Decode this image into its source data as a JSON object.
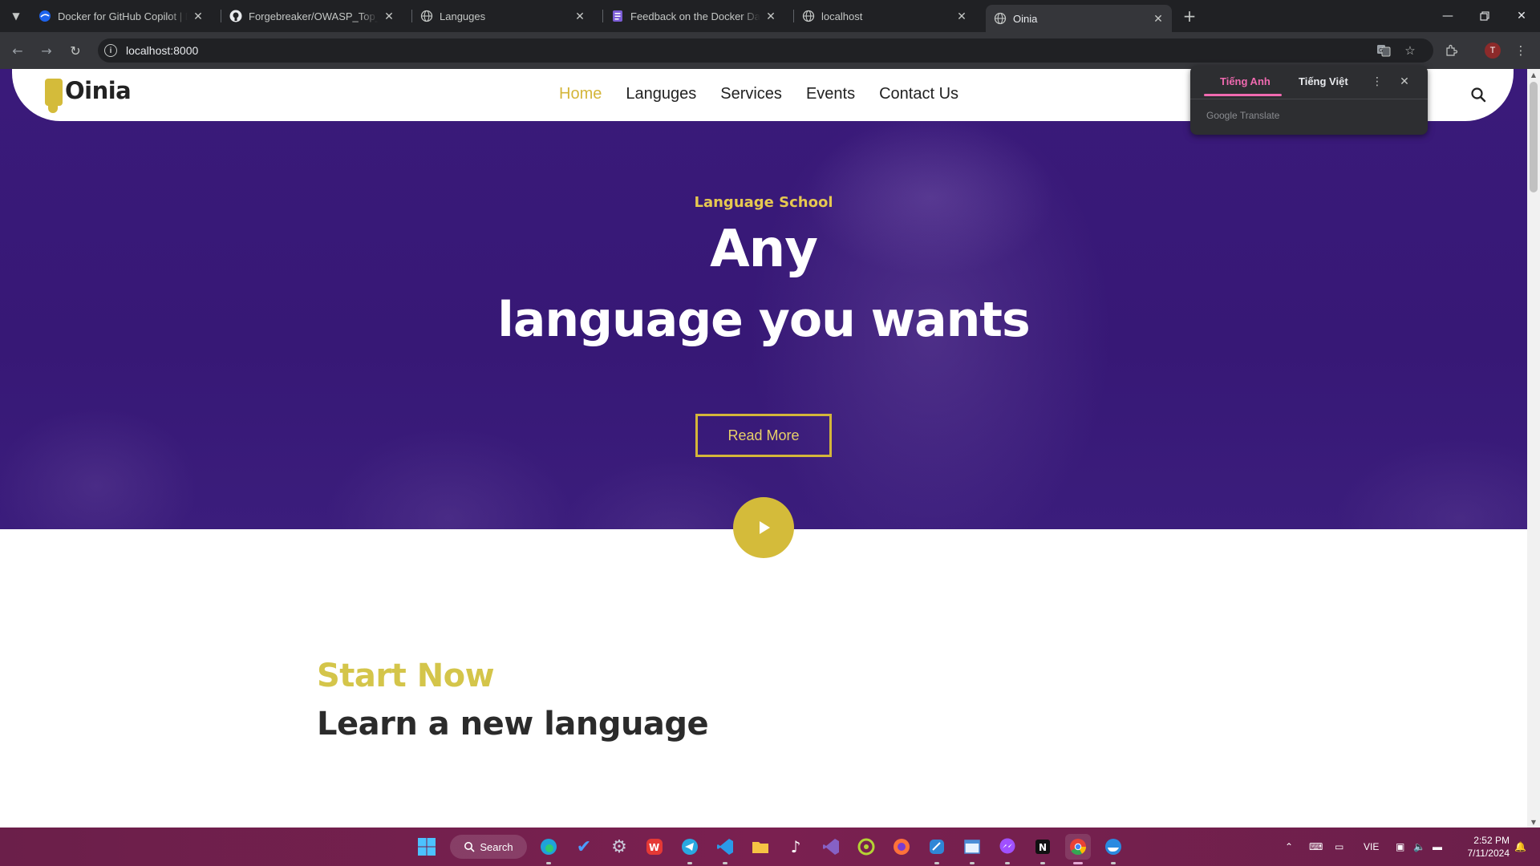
{
  "browser": {
    "tabs": [
      {
        "title": "Docker for GitHub Copilot | Do",
        "icon": "docker-favicon",
        "active": false
      },
      {
        "title": "Forgebreaker/OWASP_Top_10_2",
        "icon": "github-favicon",
        "active": false
      },
      {
        "title": "Languges",
        "icon": "globe-favicon",
        "active": false
      },
      {
        "title": "Feedback on the Docker Dashb",
        "icon": "form-favicon",
        "active": false
      },
      {
        "title": "localhost",
        "icon": "globe-favicon",
        "active": false
      },
      {
        "title": "Oinia",
        "icon": "globe-favicon",
        "active": true
      }
    ],
    "url": "localhost:8000",
    "profile_initial": "T",
    "colors": {
      "tabbar": "#202124",
      "toolbar": "#35363a"
    }
  },
  "translate_popup": {
    "source_lang": "Tiếng Anh",
    "target_lang": "Tiếng Việt",
    "brand": "Google Translate",
    "accent": "#f06ab0"
  },
  "site": {
    "logo_text": "Oinia",
    "nav": [
      "Home",
      "Languges",
      "Services",
      "Events",
      "Contact Us"
    ],
    "active_nav": "Home",
    "accent": "#d4b63a",
    "hero": {
      "subtitle": "Language School",
      "title_line1": "Any",
      "title_line2": "language you wants",
      "button": "Read More",
      "background": "#371876"
    },
    "section": {
      "kicker": "Start Now",
      "heading": "Learn a new language"
    }
  },
  "taskbar": {
    "search_label": "Search",
    "language": "VIE",
    "time": "2:52 PM",
    "date": "7/11/2024"
  }
}
